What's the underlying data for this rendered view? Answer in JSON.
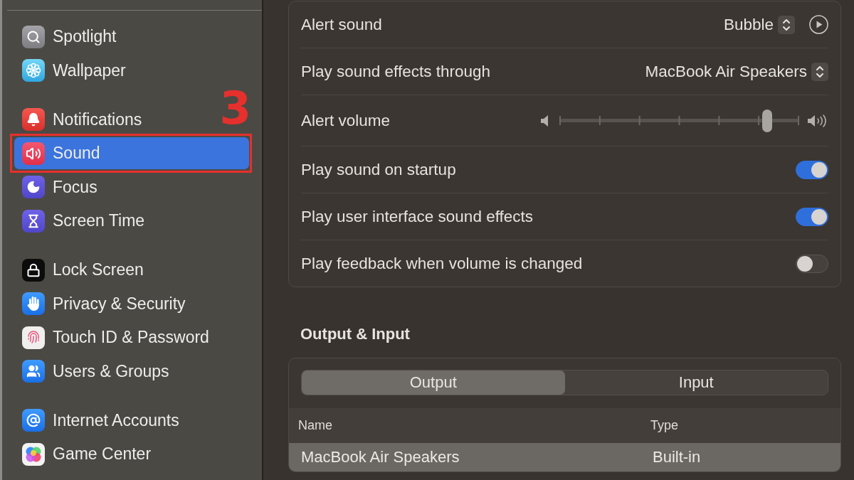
{
  "sidebar": {
    "groups": [
      {
        "items": [
          {
            "label": "Spotlight",
            "selected": false
          },
          {
            "label": "Wallpaper",
            "selected": false
          }
        ]
      },
      {
        "items": [
          {
            "label": "Notifications",
            "selected": false
          },
          {
            "label": "Sound",
            "selected": true
          },
          {
            "label": "Focus",
            "selected": false
          },
          {
            "label": "Screen Time",
            "selected": false
          }
        ]
      },
      {
        "items": [
          {
            "label": "Lock Screen",
            "selected": false
          },
          {
            "label": "Privacy & Security",
            "selected": false
          },
          {
            "label": "Touch ID & Password",
            "selected": false
          },
          {
            "label": "Users & Groups",
            "selected": false
          }
        ]
      },
      {
        "items": [
          {
            "label": "Internet Accounts",
            "selected": false
          },
          {
            "label": "Game Center",
            "selected": false
          }
        ]
      }
    ]
  },
  "annotation": {
    "label": "3"
  },
  "sound_settings": {
    "rows": [
      {
        "kind": "popup",
        "label": "Alert sound",
        "value": "Bubble",
        "play_button": true
      },
      {
        "kind": "popup",
        "label": "Play sound effects through",
        "value": "MacBook Air Speakers"
      },
      {
        "kind": "slider",
        "label": "Alert volume",
        "level": 0.87
      },
      {
        "kind": "toggle",
        "label": "Play sound on startup",
        "on": true
      },
      {
        "kind": "toggle",
        "label": "Play user interface sound effects",
        "on": true
      },
      {
        "kind": "toggle",
        "label": "Play feedback when volume is changed",
        "on": false
      }
    ]
  },
  "output_input": {
    "title": "Output & Input",
    "tabs": [
      {
        "label": "Output",
        "selected": true
      },
      {
        "label": "Input",
        "selected": false
      }
    ],
    "table": {
      "columns": [
        "Name",
        "Type"
      ],
      "rows": [
        {
          "cells": [
            "MacBook Air Speakers",
            "Built-in"
          ],
          "selected": true
        }
      ]
    }
  }
}
